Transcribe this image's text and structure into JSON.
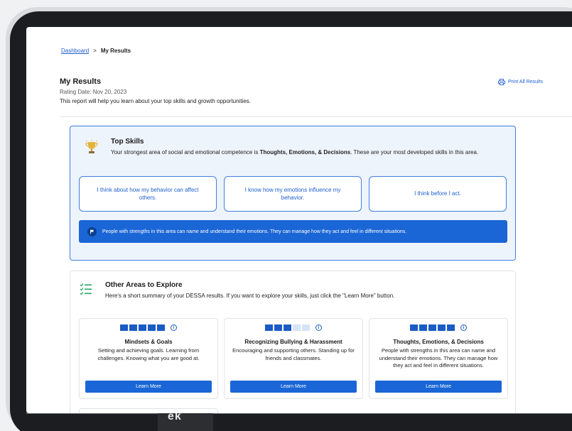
{
  "breadcrumb": {
    "link": "Dashboard",
    "separator": ">",
    "current": "My Results"
  },
  "header": {
    "title": "My Results",
    "rating_date": "Rating Date: Nov 20, 2023",
    "intro": "This report will help you learn about your top skills and growth opportunities.",
    "print_label": "Print All Results"
  },
  "top_skills": {
    "title": "Top Skills",
    "desc_prefix": "Your strongest area of social and emotional competence is ",
    "desc_bold": "Thoughts, Emotions, & Decisions",
    "desc_suffix": ". These are your most developed skills in this area.",
    "skills": [
      "I think about how my behavior can affect others.",
      "I know how my emotions influence my behavior.",
      "I think before I act."
    ],
    "banner": "People with strengths in this area can name and understand their emotions. They can manage how they act and feel in different situations."
  },
  "other_areas": {
    "title": "Other Areas to Explore",
    "desc": "Here's a short summary of your DESSA results. If you want to explore your skills, just click the \"Learn More\" button.",
    "cards": [
      {
        "title": "Mindsets & Goals",
        "desc": "Setting and achieving goals. Learning from challenges. Knowing what you are good at.",
        "level": 5,
        "button": "Learn More"
      },
      {
        "title": "Recognizing Bullying & Harassment",
        "desc": "Encouraging and supporting others. Standing up for friends and classmates.",
        "level": 3,
        "button": "Learn More"
      },
      {
        "title": "Thoughts, Emotions, & Decisions",
        "desc": "People with strengths in this area can name and understand their emotions. They can manage how they act and feel in different situations.",
        "level": 5,
        "button": "Learn More"
      }
    ],
    "level_max": 5
  },
  "info_glyph": "i",
  "device_label": "ek",
  "colors": {
    "accent": "#1a66d6",
    "link": "#1f5fcf",
    "top_card_bg": "#eef4fc"
  },
  "icons": [
    "printer-icon",
    "trophy-icon",
    "flag-icon",
    "checklist-icon",
    "info-icon"
  ]
}
